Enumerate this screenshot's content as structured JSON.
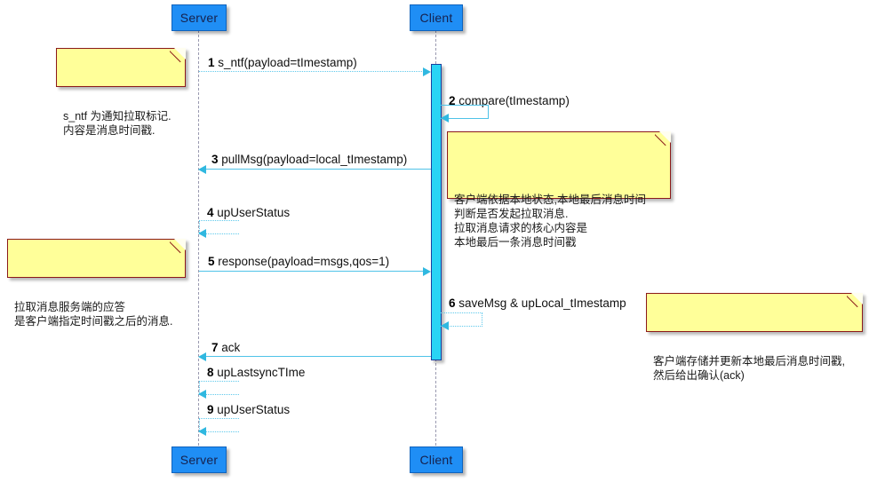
{
  "diagram": {
    "type": "uml-sequence-diagram",
    "title": "",
    "colors": {
      "participant_fill": "#1f8ef5",
      "participant_border": "#0f63bd",
      "activation_fill": "#29d4f5",
      "activation_border": "#1a3f9e",
      "note_fill": "#ffff99",
      "note_border": "#8b1a1a",
      "message_line": "#4fc3e8",
      "background": "#ffffff"
    }
  },
  "participants": [
    {
      "id": "server",
      "label": "Server"
    },
    {
      "id": "client",
      "label": "Client"
    }
  ],
  "participants_bottom": [
    {
      "id": "server",
      "label": "Server"
    },
    {
      "id": "client",
      "label": "Client"
    }
  ],
  "messages": [
    {
      "num": "1",
      "text": "s_ntf(payload=tImestamp)",
      "from": "server",
      "to": "client",
      "style": "dotted",
      "direction": "right",
      "self": false
    },
    {
      "num": "2",
      "text": "compare(tImestamp)",
      "from": "client",
      "to": "client",
      "style": "solid",
      "direction": "self",
      "self": true
    },
    {
      "num": "3",
      "text": "pullMsg(payload=local_tImestamp)",
      "from": "client",
      "to": "server",
      "style": "solid",
      "direction": "left",
      "self": false
    },
    {
      "num": "4",
      "text": "upUserStatus",
      "from": "server",
      "to": "server",
      "style": "dotted",
      "direction": "self",
      "self": true
    },
    {
      "num": "5",
      "text": "response(payload=msgs,qos=1)",
      "from": "server",
      "to": "client",
      "style": "solid",
      "direction": "right",
      "self": false
    },
    {
      "num": "6",
      "text": "saveMsg & upLocal_tImestamp",
      "from": "client",
      "to": "client",
      "style": "dotted",
      "direction": "self",
      "self": true
    },
    {
      "num": "7",
      "text": "ack",
      "from": "client",
      "to": "server",
      "style": "solid",
      "direction": "left",
      "self": false
    },
    {
      "num": "8",
      "text": "upLastsyncTIme",
      "from": "server",
      "to": "server",
      "style": "dotted",
      "direction": "self",
      "self": true
    },
    {
      "num": "9",
      "text": "upUserStatus",
      "from": "server",
      "to": "server",
      "style": "dotted",
      "direction": "self",
      "self": true
    }
  ],
  "notes": [
    {
      "id": "note-s-ntf",
      "text": "s_ntf 为通知拉取标记.\n内容是消息时间戳."
    },
    {
      "id": "note-client-compare",
      "text": "客户端依据本地状态,本地最后消息时间\n判断是否发起拉取消息.\n拉取消息请求的核心内容是\n本地最后一条消息时间戳"
    },
    {
      "id": "note-pull-response",
      "text": "拉取消息服务端的应答\n是客户端指定时间戳之后的消息."
    },
    {
      "id": "note-save-ack",
      "text": "客户端存储并更新本地最后消息时间戳,\n然后给出确认(ack)"
    }
  ]
}
